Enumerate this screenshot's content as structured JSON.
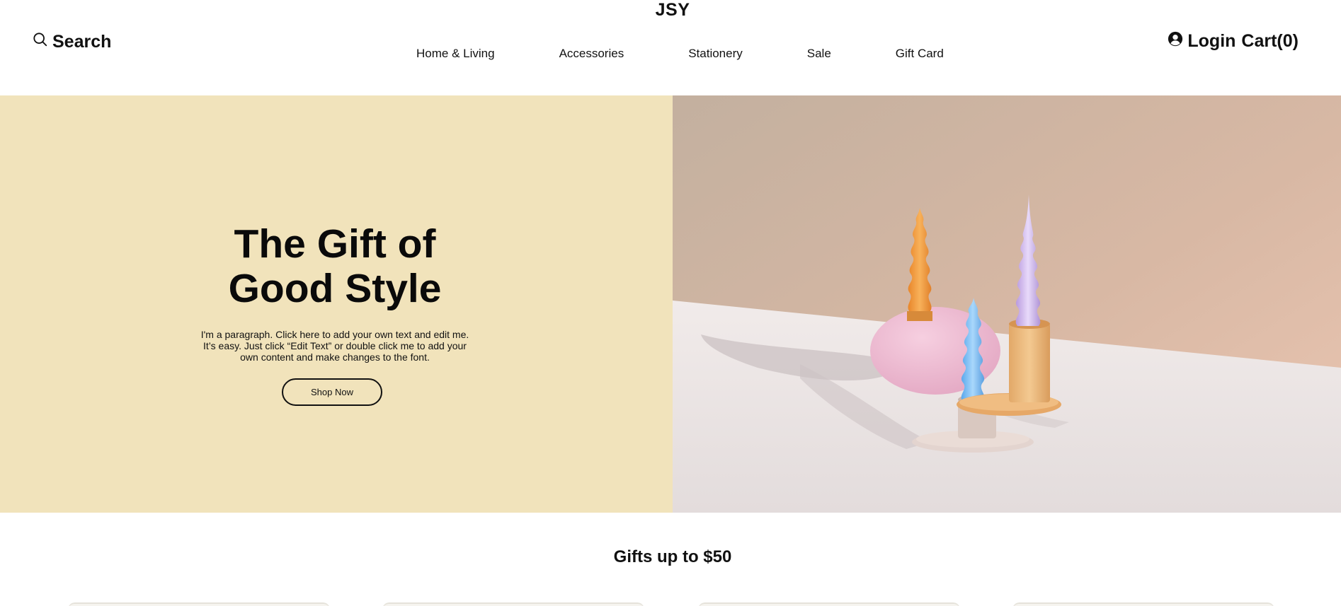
{
  "header": {
    "brand": "JSY",
    "search_label": "Search",
    "nav": [
      "Home & Living",
      "Accessories",
      "Stationery",
      "Sale",
      "Gift Card"
    ],
    "login_label": "Login",
    "cart_label": "Cart(0)"
  },
  "hero": {
    "title_line1": "The Gift of",
    "title_line2": "Good Style",
    "paragraph": "I'm a paragraph. Click here to add your own text and edit me. It’s easy. Just click “Edit Text” or double click me to add your own content and make changes to the font.",
    "button_label": "Shop Now",
    "background_color": "#f1e3bb"
  },
  "section": {
    "title": "Gifts up to $50"
  },
  "icons": {
    "search": "search-icon",
    "account": "user-circle-icon"
  }
}
